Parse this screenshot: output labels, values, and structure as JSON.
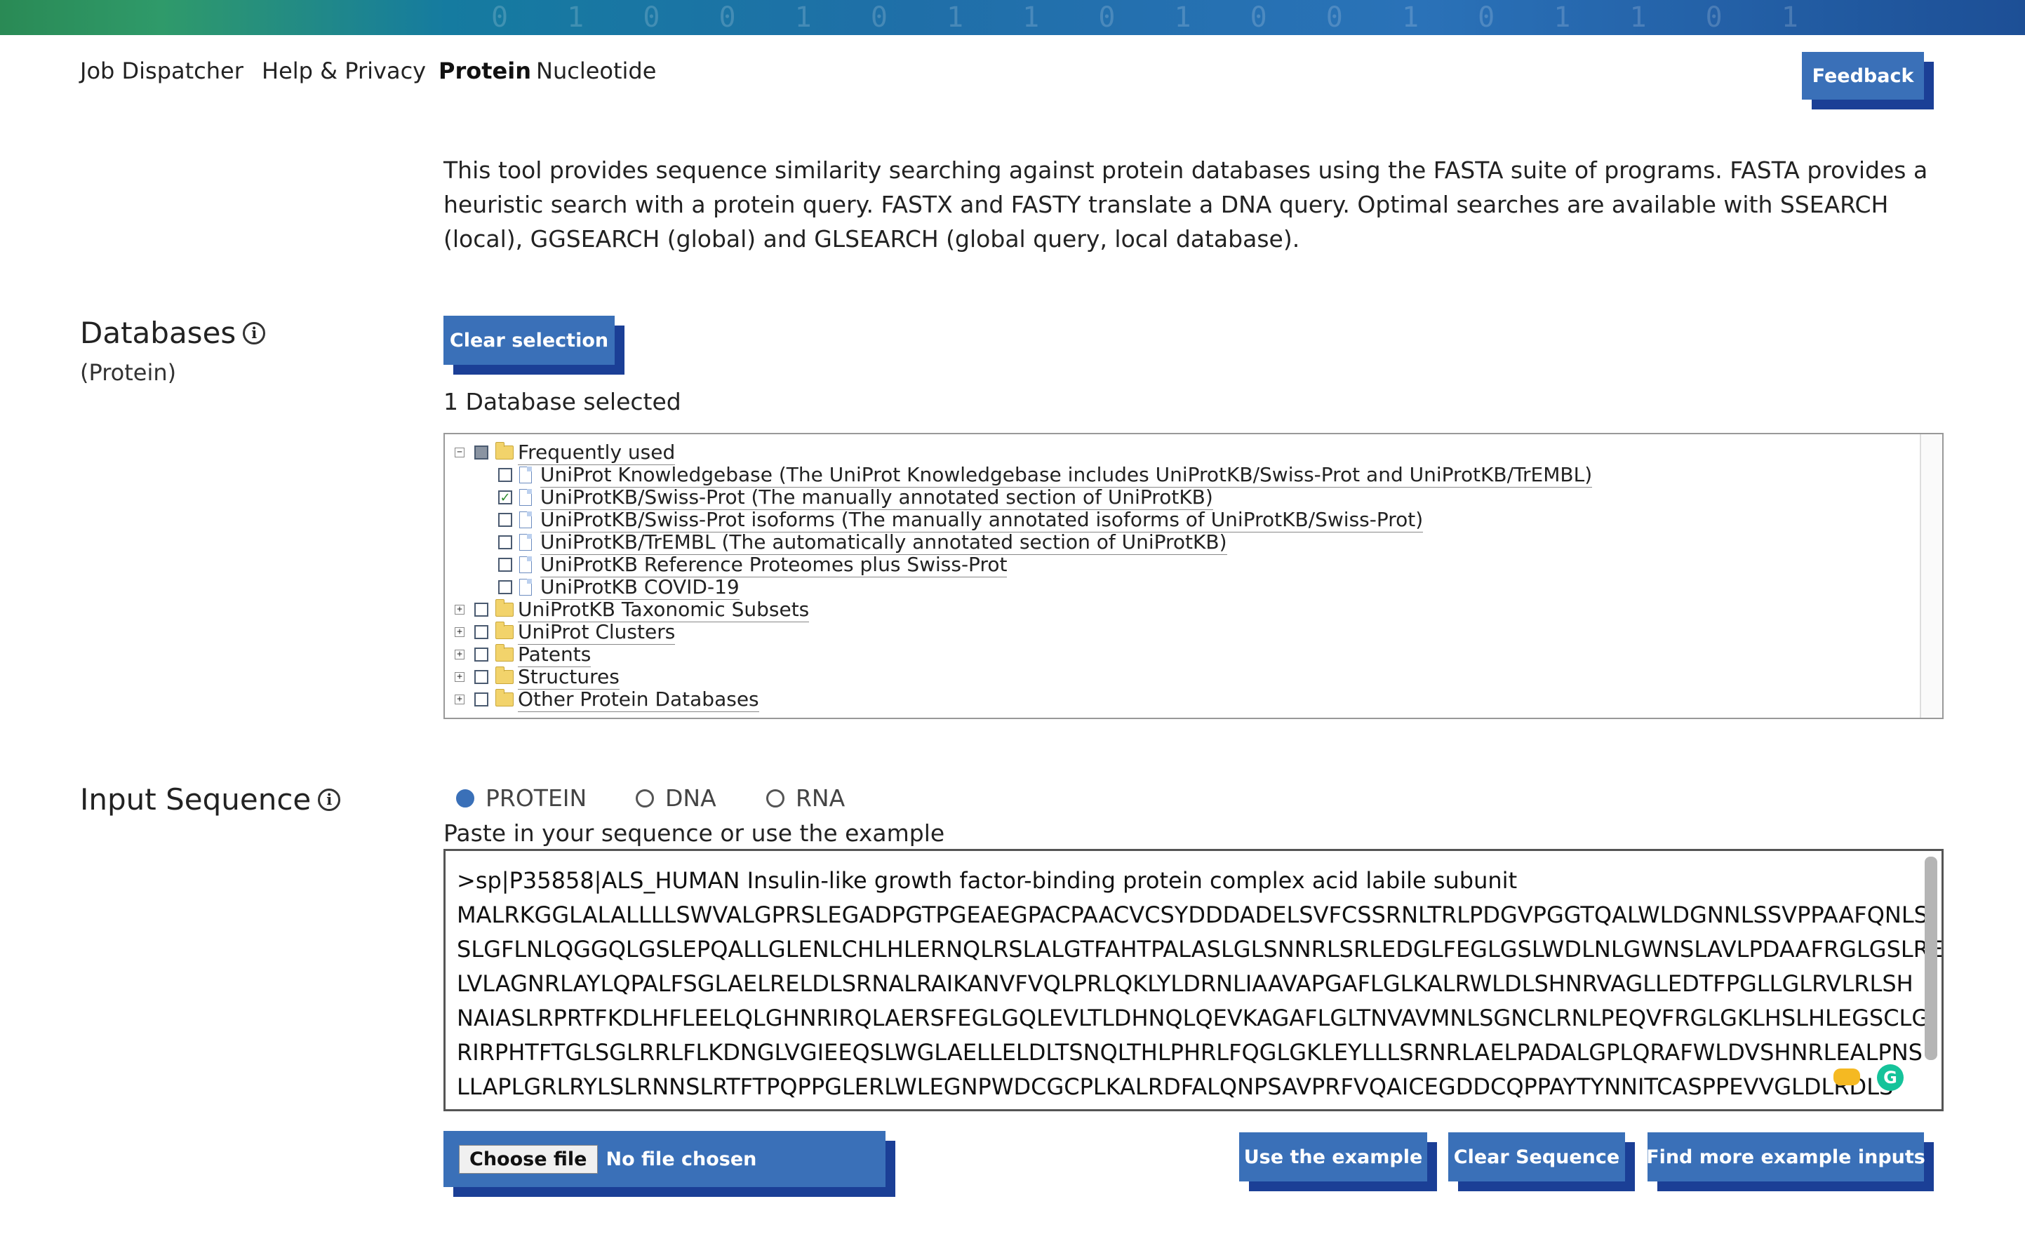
{
  "nav": {
    "links": [
      "Job Dispatcher",
      "Help & Privacy",
      "Protein",
      "Nucleotide"
    ],
    "active": "Protein",
    "feedback_label": "Feedback"
  },
  "intro": "This tool provides sequence similarity searching against protein databases using the FASTA suite of programs. FASTA provides a heuristic search with a protein query. FASTX and FASTY translate a DNA query. Optimal searches are available with SSEARCH (local), GGSEARCH (global) and GLSEARCH (global query, local database).",
  "databases": {
    "title": "Databases",
    "subtitle": "(Protein)",
    "clear_label": "Clear selection",
    "count_text": "1 Database selected",
    "tree": {
      "frequently_used": "Frequently used",
      "items": [
        {
          "label": "UniProt Knowledgebase (The UniProt Knowledgebase includes UniProtKB/Swiss-Prot and UniProtKB/TrEMBL)",
          "checked": false
        },
        {
          "label": "UniProtKB/Swiss-Prot (The manually annotated section of UniProtKB)",
          "checked": true
        },
        {
          "label": "UniProtKB/Swiss-Prot isoforms (The manually annotated isoforms of UniProtKB/Swiss-Prot)",
          "checked": false
        },
        {
          "label": "UniProtKB/TrEMBL (The automatically annotated section of UniProtKB)",
          "checked": false
        },
        {
          "label": "UniProtKB Reference Proteomes plus Swiss-Prot",
          "checked": false
        },
        {
          "label": "UniProtKB COVID-19",
          "checked": false
        }
      ],
      "groups": [
        "UniProtKB Taxonomic Subsets",
        "UniProt Clusters",
        "Patents",
        "Structures",
        "Other Protein Databases"
      ]
    }
  },
  "input": {
    "title": "Input Sequence",
    "radios": [
      "PROTEIN",
      "DNA",
      "RNA"
    ],
    "selected": "PROTEIN",
    "hint": "Paste in your sequence or use the example",
    "sequence": ">sp|P35858|ALS_HUMAN Insulin-like growth factor-binding protein complex acid labile subunit\nMALRKGGLALALLLLSWVALGPRSLEGADPGTPGEAEGPACPAACVCSYDDDADELSVFCSSRNLTRLPDGVPGGTQALWLDGNNLSSVPPAAFQNLS\nSLGFLNLQGGQLGSLEPQALLGLENLCHLHLERNQLRSLALGTFAHTPALASLGLSNNRLSRLEDGLFEGLGSLWDLNLGWNSLAVLPDAAFRGLGSLRE\nLVLAGNRLAYLQPALFSGLAELRELDLSRNALRAIKANVFVQLPRLQKLYLDRNLIAAVAPGAFLGLKALRWLDLSHNRVAGLLEDTFPGLLGLRVLRLSH\nNAIASLRPRTFKDLHFLEELQLGHNRIRQLAERSFEGLGQLEVLTLDHNQLQEVKAGAFLGLTNVAVMNLSGNCLRNLPEQVFRGLGKLHSLHLEGSCLG\nRIRPHTFTGLSGLRRLFLKDNGLVGIEEQSLWGLAELLELDLTSNQLTHLPHRLFQGLGKLEYLLLSRNRLAELPADALGPLQRAFWLDVSHNRLEALPNS\nLLAPLGRLRYLSLRNNSLRTFTPQPPGLERLWLEGNPWDCGCPLKALRDFALQNPSAVPRFVQAICEGDDCQPPAYTYNNITCASPPEVVGLDLRDLS",
    "file_button": "Choose file",
    "file_status": "No file chosen",
    "use_example": "Use the example",
    "clear_sequence": "Clear Sequence",
    "more_examples": "Find more example inputs"
  }
}
